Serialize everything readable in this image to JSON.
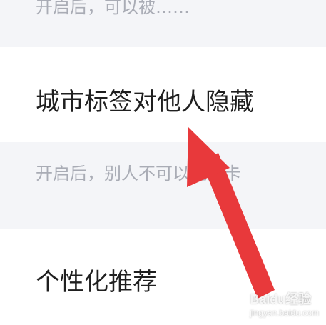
{
  "settings": {
    "prev_item_description": "开启后，可以被……",
    "city_tag_label": "城市标签对他人隐藏",
    "city_tag_description": "开启后，别人不可以通过卡",
    "recommendation_label": "个性化推荐"
  },
  "watermark": {
    "brand": "Baidu经验",
    "url": "jingyan.baidu.com"
  },
  "colors": {
    "arrow": "#e8393b",
    "page_bg": "#f4f5f8",
    "row_bg": "#ffffff"
  }
}
